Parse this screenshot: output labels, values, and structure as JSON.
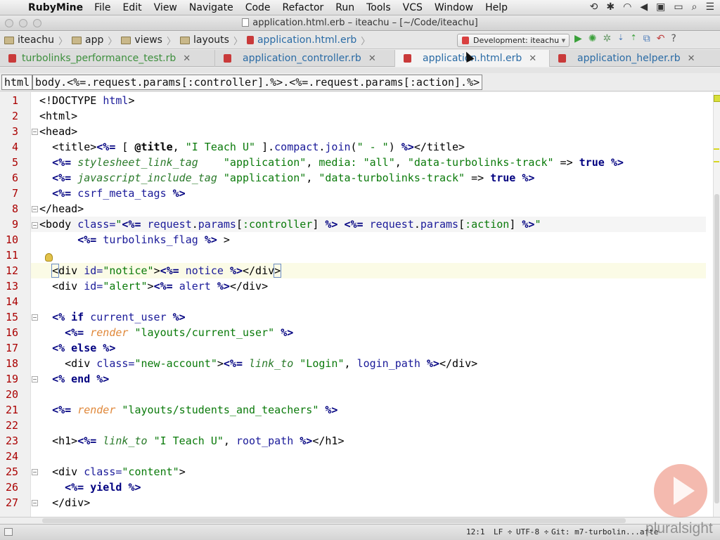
{
  "menubar": {
    "app": "RubyMine",
    "items": [
      "File",
      "Edit",
      "View",
      "Navigate",
      "Code",
      "Refactor",
      "Run",
      "Tools",
      "VCS",
      "Window",
      "Help"
    ]
  },
  "window": {
    "title": "application.html.erb – iteachu – [~/Code/iteachu]"
  },
  "breadcrumb": [
    "iteachu",
    "app",
    "views",
    "layouts",
    "application.html.erb"
  ],
  "run_config": "Development: iteachu",
  "tabs": [
    {
      "label": "turbolinks_performance_test.rb",
      "state": "normal",
      "color": "green"
    },
    {
      "label": "application_controller.rb",
      "state": "normal",
      "color": "blue"
    },
    {
      "label": "application.html.erb",
      "state": "active",
      "color": "blue"
    },
    {
      "label": "application_helper.rb",
      "state": "normal",
      "color": "blue"
    }
  ],
  "tag_crumbs": [
    "html",
    "body.<%=.request.params[:controller].%>.<%=.request.params[:action].%>"
  ],
  "code_lines": [
    {
      "n": "1"
    },
    {
      "n": "2"
    },
    {
      "n": "3"
    },
    {
      "n": "4"
    },
    {
      "n": "5"
    },
    {
      "n": "6"
    },
    {
      "n": "7"
    },
    {
      "n": "8"
    },
    {
      "n": "9"
    },
    {
      "n": "10"
    },
    {
      "n": "11"
    },
    {
      "n": "12"
    },
    {
      "n": "13"
    },
    {
      "n": "14"
    },
    {
      "n": "15"
    },
    {
      "n": "16"
    },
    {
      "n": "17"
    },
    {
      "n": "18"
    },
    {
      "n": "19"
    },
    {
      "n": "20"
    },
    {
      "n": "21"
    },
    {
      "n": "22"
    },
    {
      "n": "23"
    },
    {
      "n": "24"
    },
    {
      "n": "25"
    },
    {
      "n": "26"
    },
    {
      "n": "27"
    }
  ],
  "status": {
    "position": "12:1",
    "line_sep": "LF ÷",
    "encoding": "UTF-8 ÷",
    "git": "Git: m7-turbolin...afte"
  },
  "watermark": "pluralsight"
}
